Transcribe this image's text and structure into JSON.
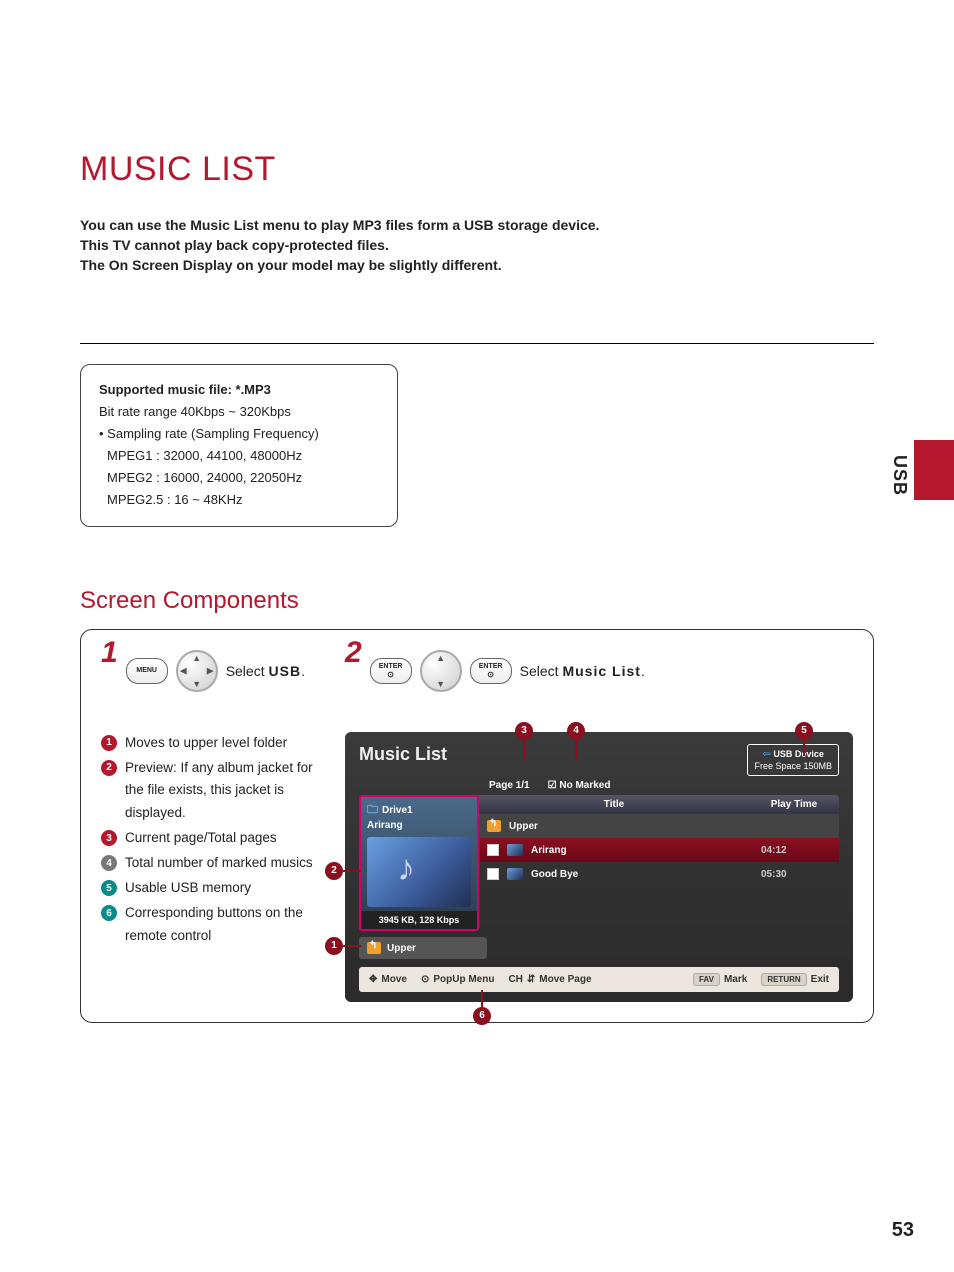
{
  "page_title": "MUSIC LIST",
  "intro": {
    "p1": "You can use the Music List menu to play MP3 files form a USB storage device.",
    "p2": "This TV cannot play back copy-protected files.",
    "p3": "The On Screen Display on your model may be slightly different."
  },
  "spec": {
    "heading": "Supported music file: *.MP3",
    "bitrate": "Bit rate range 40Kbps ~ 320Kbps",
    "bullet": "• Sampling rate (Sampling Frequency)",
    "m1": "MPEG1 : 32000, 44100, 48000Hz",
    "m2": "MPEG2 : 16000, 24000, 22050Hz",
    "m3": "MPEG2.5 : 16 ~ 48KHz"
  },
  "side_label": "USB",
  "section_title": "Screen Components",
  "steps": {
    "s1_num": "1",
    "s1_btn": "MENU",
    "s1_text_pre": "Select ",
    "s1_text_bold": "USB",
    "s1_text_post": ".",
    "s2_num": "2",
    "s2_btn": "ENTER",
    "s2_text_pre": "Select ",
    "s2_text_bold": "Music List",
    "s2_text_post": "."
  },
  "legend": [
    {
      "n": "1",
      "cls": "nb-red",
      "text": "Moves to upper level folder"
    },
    {
      "n": "2",
      "cls": "nb-red",
      "text": "Preview: If any album jacket for the file exists, this jacket is displayed."
    },
    {
      "n": "3",
      "cls": "nb-red",
      "text": "Current page/Total pages"
    },
    {
      "n": "4",
      "cls": "nb-gray",
      "text": "Total number of marked musics"
    },
    {
      "n": "5",
      "cls": "nb-teal",
      "text": "Usable USB memory"
    },
    {
      "n": "6",
      "cls": "nb-teal",
      "text": "Corresponding buttons on the remote control"
    }
  ],
  "app": {
    "title": "Music List",
    "usb_device": "USB Device",
    "free_space": "Free Space 150MB",
    "page": "Page 1/1",
    "marked": "No Marked",
    "drive": "Drive1",
    "playing": "Arirang",
    "meta": "3945 KB, 128 Kbps",
    "col_title": "Title",
    "col_time": "Play Time",
    "rows": [
      {
        "type": "upper",
        "name": "Upper",
        "time": ""
      },
      {
        "type": "hl",
        "name": "Arirang",
        "time": "04:12"
      },
      {
        "type": "normal",
        "name": "Good Bye",
        "time": "05:30"
      }
    ],
    "upper_btn": "Upper"
  },
  "footer": {
    "move": "Move",
    "popup": "PopUp Menu",
    "ch": "CH",
    "movepage": "Move Page",
    "fav": "FAV",
    "mark": "Mark",
    "return": "RETURN",
    "exit": "Exit"
  },
  "callouts": {
    "c1": "1",
    "c2": "2",
    "c3": "3",
    "c4": "4",
    "c5": "5",
    "c6": "6"
  },
  "page_number": "53"
}
